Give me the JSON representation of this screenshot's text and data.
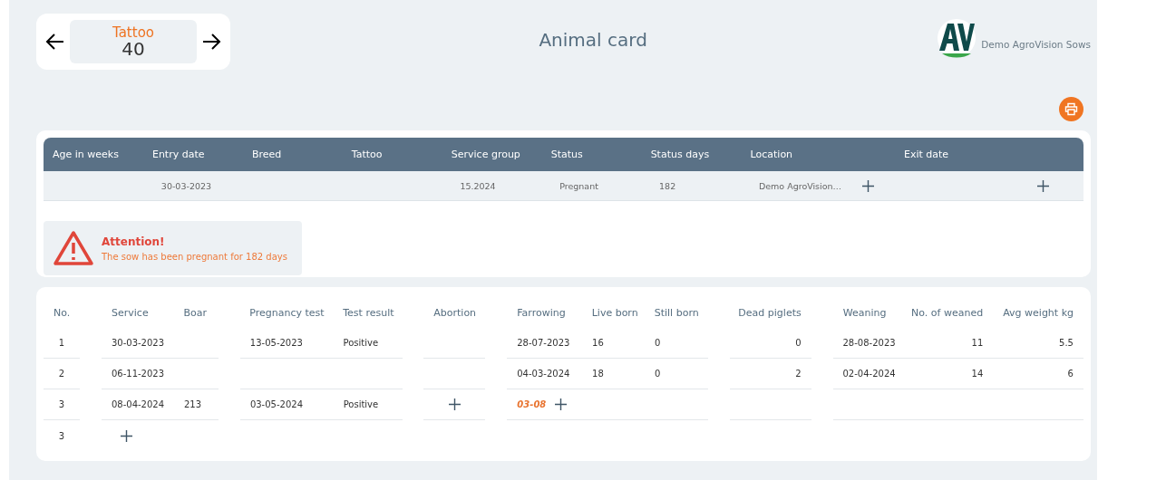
{
  "navigator": {
    "label": "Tattoo",
    "value": "40"
  },
  "title": "Animal card",
  "user": {
    "farm": "Demo AgroVision Sows"
  },
  "animal_table": {
    "columns": [
      "Age in weeks",
      "Entry date",
      "Breed",
      "Tattoo",
      "Service group",
      "Status",
      "Status days",
      "Location",
      "Exit date"
    ],
    "row": [
      {
        "kind": "empty"
      },
      {
        "kind": "text",
        "text": "30-03-2023"
      },
      {
        "kind": "empty"
      },
      {
        "kind": "empty"
      },
      {
        "kind": "text",
        "text": "15.2024"
      },
      {
        "kind": "text",
        "text": "Pregnant"
      },
      {
        "kind": "text",
        "text": "182"
      },
      {
        "kind": "text",
        "text": "Demo AgroVision…"
      },
      {
        "kind": "add"
      },
      {
        "kind": "empty"
      },
      {
        "kind": "add"
      }
    ]
  },
  "alert": {
    "title": "Attention!",
    "message": "The sow has been pregnant for 182 days"
  },
  "history_table": {
    "columns": [
      "No.",
      "Service",
      "Boar",
      "Pregnancy test",
      "Test result",
      "Abortion",
      "Farrowing",
      "Live born",
      "Still born",
      "Dead piglets",
      "Weaning",
      "No. of weaned",
      "Avg weight kg"
    ],
    "rows": [
      {
        "cells": [
          {
            "kind": "text",
            "text": "1"
          },
          {
            "kind": "text",
            "text": "30-03-2023"
          },
          {
            "kind": "empty"
          },
          {
            "kind": "text",
            "text": "13-05-2023"
          },
          {
            "kind": "text",
            "text": "Positive"
          },
          {
            "kind": "empty"
          },
          {
            "kind": "text",
            "text": "28-07-2023"
          },
          {
            "kind": "text",
            "text": "16"
          },
          {
            "kind": "text",
            "text": "0"
          },
          {
            "kind": "text",
            "text": "0"
          },
          {
            "kind": "text",
            "text": "28-08-2023"
          },
          {
            "kind": "text",
            "text": "11"
          },
          {
            "kind": "text",
            "text": "5.5"
          }
        ]
      },
      {
        "cells": [
          {
            "kind": "text",
            "text": "2"
          },
          {
            "kind": "text",
            "text": "06-11-2023"
          },
          {
            "kind": "empty"
          },
          {
            "kind": "empty"
          },
          {
            "kind": "empty"
          },
          {
            "kind": "empty"
          },
          {
            "kind": "text",
            "text": "04-03-2024"
          },
          {
            "kind": "text",
            "text": "18"
          },
          {
            "kind": "text",
            "text": "0"
          },
          {
            "kind": "text",
            "text": "2"
          },
          {
            "kind": "text",
            "text": "02-04-2024"
          },
          {
            "kind": "text",
            "text": "14"
          },
          {
            "kind": "text",
            "text": "6"
          }
        ]
      },
      {
        "cells": [
          {
            "kind": "text",
            "text": "3"
          },
          {
            "kind": "text",
            "text": "08-04-2024"
          },
          {
            "kind": "text",
            "text": "213"
          },
          {
            "kind": "text",
            "text": "03-05-2024"
          },
          {
            "kind": "text",
            "text": "Positive"
          },
          {
            "kind": "add"
          },
          {
            "kind": "due",
            "text": "03-08"
          },
          {
            "kind": "empty"
          },
          {
            "kind": "empty"
          },
          {
            "kind": "empty"
          },
          {
            "kind": "empty"
          },
          {
            "kind": "empty"
          },
          {
            "kind": "empty"
          }
        ]
      },
      {
        "cells": [
          {
            "kind": "text",
            "text": "3"
          },
          {
            "kind": "add"
          }
        ]
      }
    ]
  }
}
